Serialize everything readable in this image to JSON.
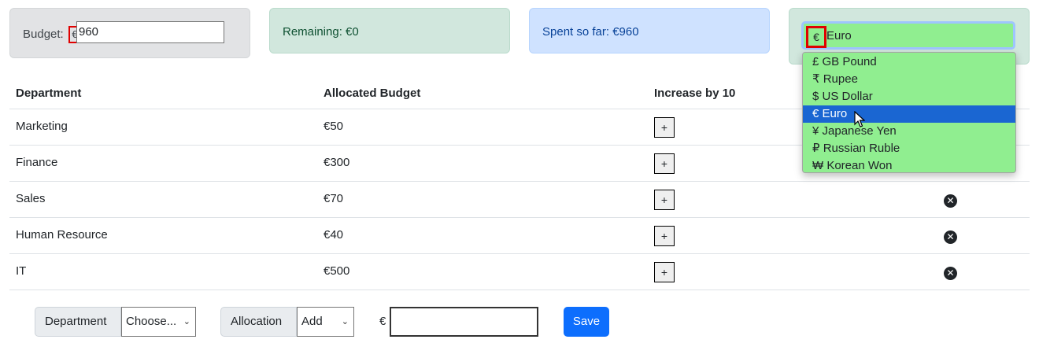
{
  "summary": {
    "budget_label": "Budget:",
    "budget_currency_symbol": "€",
    "budget_value": "960",
    "remaining_text": "Remaining: €0",
    "spent_text": "Spent so far: €960"
  },
  "currency": {
    "selected_symbol": "€",
    "selected_name": "Euro",
    "options": [
      {
        "label": "£ GB Pound"
      },
      {
        "label": "₹ Rupee"
      },
      {
        "label": "$ US Dollar"
      },
      {
        "label": "€ Euro"
      },
      {
        "label": "¥ Japanese Yen"
      },
      {
        "label": "₽ Russian Ruble"
      },
      {
        "label": "₩ Korean Won"
      }
    ]
  },
  "table": {
    "headers": [
      "Department",
      "Allocated Budget",
      "Increase by 10"
    ],
    "rows": [
      {
        "department": "Marketing",
        "budget": "€50"
      },
      {
        "department": "Finance",
        "budget": "€300"
      },
      {
        "department": "Sales",
        "budget": "€70"
      },
      {
        "department": "Human Resource",
        "budget": "€40"
      },
      {
        "department": "IT",
        "budget": "€500"
      }
    ],
    "increase_label": "+",
    "delete_glyph": "✕"
  },
  "form": {
    "department_label": "Department",
    "department_value": "Choose...",
    "allocation_label": "Allocation",
    "allocation_value": "Add",
    "currency_symbol": "€",
    "amount_value": "",
    "save_label": "Save"
  },
  "colors": {
    "currency_bg": "#90ee90",
    "selected_option": "#1a66d2",
    "save_button": "#0d6efd",
    "highlight_box": "#e00000"
  }
}
